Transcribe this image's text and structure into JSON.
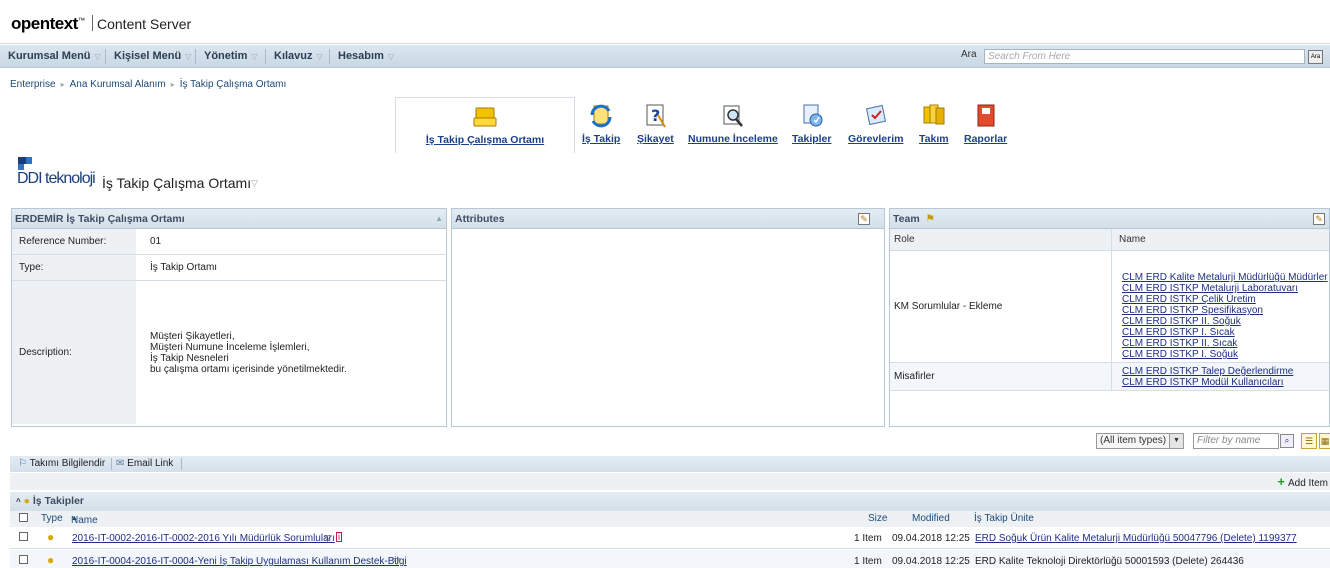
{
  "header": {
    "brand": "opentext",
    "brand_tm": "™",
    "product": "Content Server"
  },
  "nav": {
    "menus": [
      "Kurumsal Menü",
      "Kişisel Menü",
      "Yönetim",
      "Kılavuz",
      "Hesabım"
    ],
    "search_label": "Ara",
    "search_placeholder": "Search From Here",
    "search_button": "Ara"
  },
  "breadcrumb": [
    "Enterprise",
    "Ana Kurumsal Alanım",
    "İş Takip Çalışma Ortamı"
  ],
  "tabs": [
    {
      "label": "İş Takip Çalışma Ortamı",
      "icon": "folder-icon"
    },
    {
      "label": "İş Takip",
      "icon": "sync-icon"
    },
    {
      "label": "Şikayet",
      "icon": "question-doc-icon"
    },
    {
      "label": "Numune İnceleme",
      "icon": "magnify-doc-icon"
    },
    {
      "label": "Takipler",
      "icon": "tracking-icon"
    },
    {
      "label": "Görevlerim",
      "icon": "task-icon"
    },
    {
      "label": "Takım",
      "icon": "team-icon"
    },
    {
      "label": "Raporlar",
      "icon": "report-icon"
    }
  ],
  "workspace": {
    "logo_text": "DDI teknoloji",
    "title": "İş Takip Çalışma Ortamı"
  },
  "info_panel": {
    "title": "ERDEMİR İş Takip Çalışma Ortamı",
    "reference_label": "Reference Number:",
    "reference_value": "01",
    "type_label": "Type:",
    "type_value": "İş Takip Ortamı",
    "description_label": "Description:",
    "description_lines": [
      "Müşteri Şikayetleri,",
      "Müşteri Numune İnceleme İşlemleri,",
      "İş Takip Nesneleri",
      "bu çalışma ortamı içerisinde yönetilmektedir."
    ]
  },
  "attributes_panel": {
    "title": "Attributes"
  },
  "team_panel": {
    "title": "Team",
    "col_role": "Role",
    "col_name": "Name",
    "rows": [
      {
        "role": "KM Sorumlular - Ekleme",
        "names": [
          "CLM ERD Kalite Metalurji Müdürlüğü Müdürler",
          "CLM ERD ISTKP Metalurji Laboratuvarı",
          "CLM ERD ISTKP Çelik Üretim",
          "CLM ERD ISTKP Spesifikasyon",
          "CLM ERD ISTKP II. Soğuk",
          "CLM ERD ISTKP I. Sıcak",
          "CLM ERD ISTKP II. Sıcak",
          "CLM ERD ISTKP I. Soğuk"
        ]
      },
      {
        "role": "Misafirler",
        "names": [
          "CLM ERD ISTKP Talep Değerlendirme",
          "CLM ERD ISTKP Modül Kullanıcıları"
        ]
      }
    ]
  },
  "filter": {
    "select_value": "(All item types)",
    "name_placeholder": "Filter by name"
  },
  "actions": {
    "notify": "Takımı Bilgilendir",
    "email": "Email Link",
    "add_item": "Add Item"
  },
  "list": {
    "group_title": "İş Takipler",
    "col_type": "Type",
    "col_name": "Name",
    "col_size": "Size",
    "col_modified": "Modified",
    "col_unit": "İş Takip Ünite",
    "rows": [
      {
        "name": "2016-IT-0002-2016-IT-0002-2016 Yılı Müdürlük Sorumluları",
        "size": "1 Item",
        "modified": "09.04.2018 12:25",
        "unit": "ERD Soğuk Ürün Kalite Metalurji Müdürlüğü 50047796 (Delete) 1199377",
        "unit_link": true
      },
      {
        "name": "2016-IT-0004-2016-IT-0004-Yeni İş Takip Uygulaması Kullanım Destek-Bilgi",
        "size": "1 Item",
        "modified": "09.04.2018 12:25",
        "unit": "ERD Kalite Teknoloji Direktörlüğü 50001593 (Delete) 264436",
        "unit_link": false
      }
    ]
  }
}
